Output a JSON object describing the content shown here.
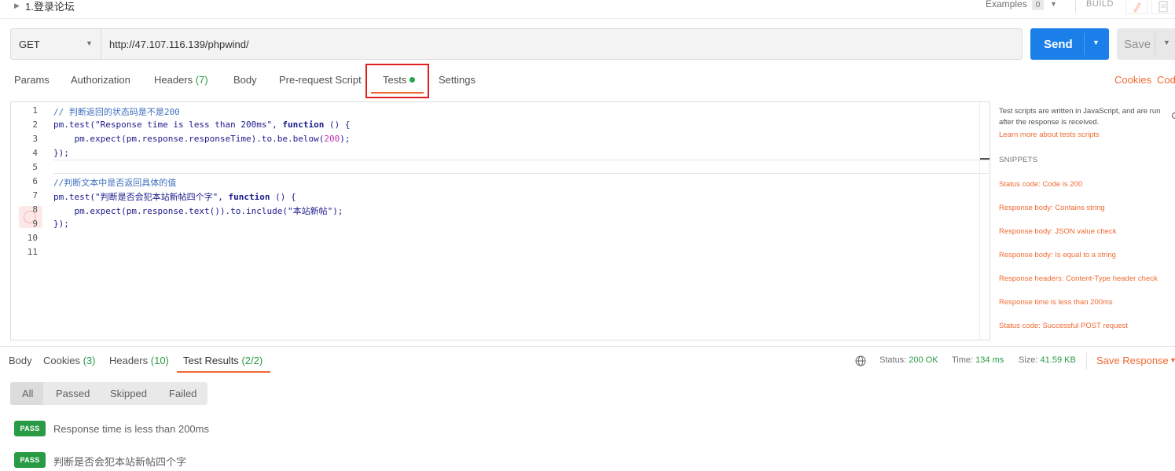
{
  "request": {
    "name": "1.登录论坛",
    "examples_label": "Examples",
    "examples_count": "0",
    "build_label": "BUILD",
    "method": "GET",
    "url": "http://47.107.116.139/phpwind/",
    "send_label": "Send",
    "save_label": "Save"
  },
  "tabs": {
    "params": "Params",
    "authorization": "Authorization",
    "headers": "Headers",
    "headers_count": "(7)",
    "body": "Body",
    "prerequest": "Pre-request Script",
    "tests": "Tests",
    "settings": "Settings",
    "cookies": "Cookies",
    "code": "Cod"
  },
  "editor": {
    "line_numbers": [
      "1",
      "2",
      "3",
      "4",
      "5",
      "6",
      "7",
      "8",
      "9",
      "10",
      "11"
    ],
    "lines": {
      "l1": "// 判断返回的状态码是不是200",
      "l2a": "pm.test(",
      "l2b": "\"Response time is less than 200ms\"",
      "l2c": ", ",
      "l2d": "function",
      "l2e": " () {",
      "l3a": "    pm.expect(pm.response.responseTime).to.be.below(",
      "l3b": "200",
      "l3c": ");",
      "l4": "});",
      "l6": "//判断文本中是否返回具体的值",
      "l7a": "pm.test(",
      "l7b": "\"判断是否会犯本站新帖四个字\"",
      "l7c": ", ",
      "l7d": "function",
      "l7e": " () {",
      "l8": "    pm.expect(pm.response.text()).to.include(\"本站新帖\");",
      "l9": "});"
    }
  },
  "snippets": {
    "description": "Test scripts are written in JavaScript, and are run after the response is received.",
    "learn_more": "Learn more about tests scripts",
    "title": "SNIPPETS",
    "items": [
      "Status code: Code is 200",
      "Response body: Contains string",
      "Response body: JSON value check",
      "Response body: Is equal to a string",
      "Response headers: Content-Type header check",
      "Response time is less than 200ms",
      "Status code: Successful POST request"
    ]
  },
  "response": {
    "tabs": {
      "body": "Body",
      "cookies": "Cookies",
      "cookies_count": "(3)",
      "headers": "Headers",
      "headers_count": "(10)",
      "test_results": "Test Results",
      "test_results_count": "(2/2)"
    },
    "status_label": "Status:",
    "status_value": "200 OK",
    "time_label": "Time:",
    "time_value": "134 ms",
    "size_label": "Size:",
    "size_value": "41.59 KB",
    "save_response": "Save Response",
    "filters": [
      "All",
      "Passed",
      "Skipped",
      "Failed"
    ],
    "results": [
      {
        "badge": "PASS",
        "name": "Response time is less than 200ms"
      },
      {
        "badge": "PASS",
        "name": "判断是否会犯本站新帖四个字"
      }
    ]
  },
  "colors": {
    "accent": "#f06a33",
    "send": "#1a7fe8",
    "pass": "#2a9b45",
    "highlight": "#e02020"
  }
}
